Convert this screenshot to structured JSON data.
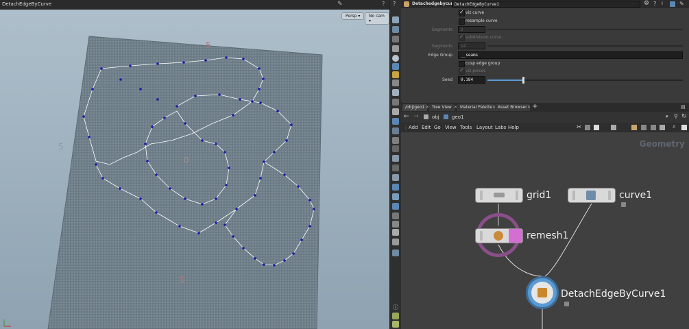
{
  "viewport": {
    "title": "DetachEdgeByCurve",
    "persp_label": "Persp",
    "cam_label": "No cam",
    "axis_labels": [
      "5",
      "0",
      "5",
      "5"
    ]
  },
  "parameters": {
    "node_type": "Detachedgebycurve",
    "node_name": "DetachEdgeByCurve1",
    "viz_curve": "viz curve",
    "resample_curve": "resample curve",
    "segments_label": "Segments",
    "segments_value": "2",
    "subdivision_curve": "subdivision curve",
    "segments2_label": "Segments",
    "segments2_value": "14",
    "edge_group_label": "Edge Group",
    "edge_group_value": "__seams",
    "cusp_edge_group": "cusp edge group",
    "viz_pieces": "viz pieces",
    "seed_label": "Seed",
    "seed_value": "0.184",
    "seed_fraction": 0.184
  },
  "network": {
    "tabs": [
      "/obj/geo1",
      "Tree View",
      "Material Palette",
      "Asset Browser"
    ],
    "path": [
      "obj",
      "geo1"
    ],
    "menus": [
      "Add",
      "Edit",
      "Go",
      "View",
      "Tools",
      "Layout",
      "Labs",
      "Help"
    ],
    "context_label": "Geometry",
    "nodes": {
      "grid": "grid1",
      "curve": "curve1",
      "remesh": "remesh1",
      "detach": "DetachEdgeByCurve1"
    }
  },
  "colors": {
    "accent_blue": "#5b9bd5",
    "remesh_ring": "#8a4f8a",
    "curve_points": "#1a1aa8"
  }
}
